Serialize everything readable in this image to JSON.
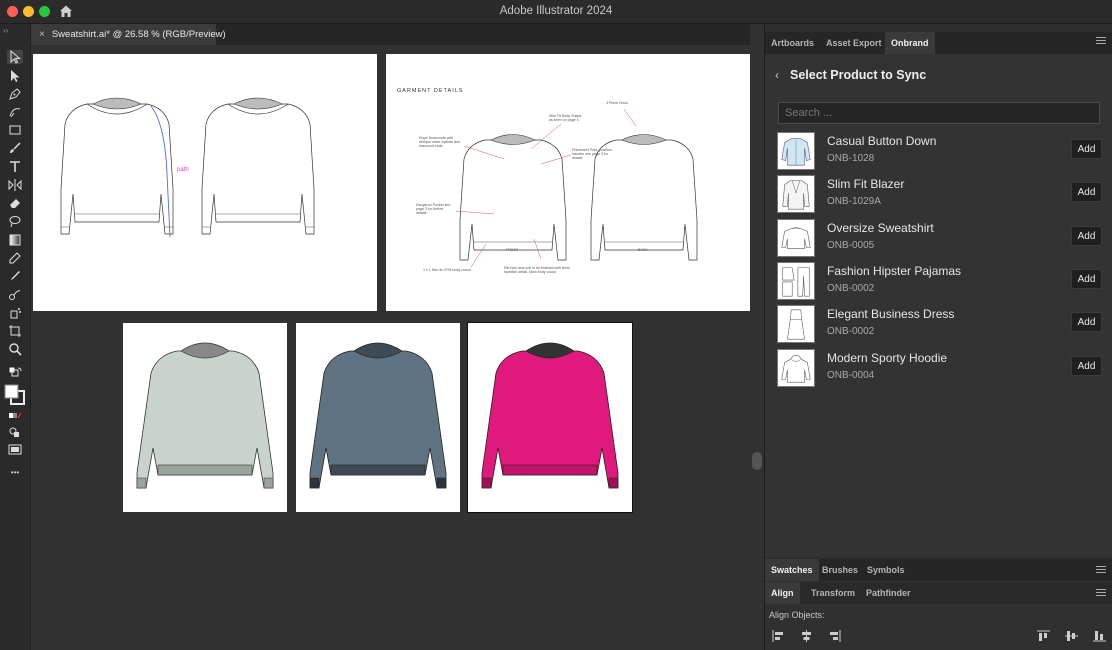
{
  "window": {
    "title": "Adobe Illustrator 2024",
    "document_tab": "Sweatshirt.ai* @ 26.58 % (RGB/Preview)",
    "close_glyph": "×",
    "collapse_glyph": "››"
  },
  "toolbar": {
    "more_glyph": "•••",
    "tools": [
      "selection-tool-icon",
      "direct-selection-tool-icon",
      "pen-tool-icon",
      "curvature-tool-icon",
      "rectangle-tool-icon",
      "paintbrush-tool-icon",
      "type-tool-icon",
      "reflect-tool-icon",
      "eraser-tool-icon",
      "lasso-tool-icon",
      "gradient-tool-icon",
      "eyedropper-tool-icon",
      "blend-tool-icon",
      "symbol-sprayer-tool-icon",
      "shape-builder-tool-icon",
      "artboard-tool-icon",
      "zoom-tool-icon"
    ]
  },
  "artboards": {
    "path_label": "path",
    "garment_title": "GARMENT DETAILS",
    "annotations": [
      "Slim Fit Body Shape as seen on page 4",
      "3 Piece Hood",
      "Rope Drawcords with Antique silver eyelets and drawcord ends",
      "Placement Print, position transfer see page 3 for details",
      "Kangaroo Pocket see page 3 for further details",
      "Rib hem and cuff to be finished with 5mm topstitch detail, Main body colour",
      "1 x 1 fine rib CFM body colour",
      "FRONT",
      "BACK"
    ]
  },
  "colors": {
    "sage": "#c9d3cb",
    "slate": "#5f7382",
    "magenta": "#e0197c",
    "accent_pink": "#e040c8"
  },
  "panel": {
    "tabs": [
      "Artboards",
      "Asset Export",
      "Onbrand"
    ],
    "active_tab": "Onbrand",
    "header": "Select Product to Sync",
    "back_glyph": "‹",
    "search_placeholder": "Search ...",
    "add_label": "Add",
    "products": [
      {
        "name": "Casual Button Down",
        "sku": "ONB-1028",
        "thumb": "shirt-thumbnail"
      },
      {
        "name": "Slim Fit Blazer",
        "sku": "ONB-1029A",
        "thumb": "blazer-thumbnail"
      },
      {
        "name": "Oversize Sweatshirt",
        "sku": "ONB-0005",
        "thumb": "sweatshirt-thumbnail"
      },
      {
        "name": "Fashion Hipster Pajamas",
        "sku": "ONB-0002",
        "thumb": "pajamas-thumbnail"
      },
      {
        "name": "Elegant Business Dress",
        "sku": "ONB-0002",
        "thumb": "dress-thumbnail"
      },
      {
        "name": "Modern Sporty Hoodie",
        "sku": "ONB-0004",
        "thumb": "hoodie-thumbnail"
      }
    ]
  },
  "lower_panels": {
    "tabs1": [
      "Swatches",
      "Brushes",
      "Symbols"
    ],
    "tabs2": [
      "Align",
      "Transform",
      "Pathfinder"
    ],
    "align_objects_label": "Align Objects:"
  }
}
